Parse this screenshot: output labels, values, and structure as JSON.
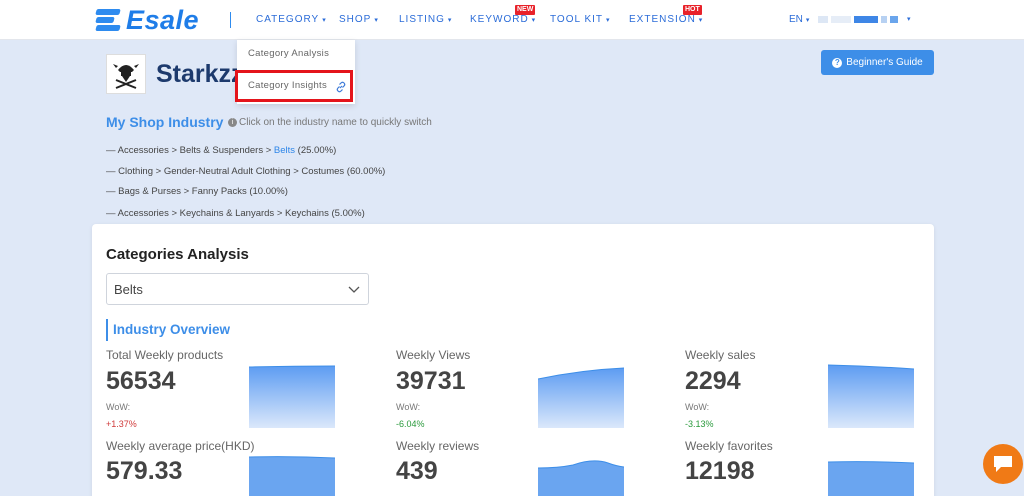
{
  "header": {
    "logo_text": "Esale",
    "nav": [
      {
        "label": "CATEGORY"
      },
      {
        "label": "SHOP"
      },
      {
        "label": "LISTING"
      },
      {
        "label": "KEYWORD",
        "badge": "NEW"
      },
      {
        "label": "TOOL KIT"
      },
      {
        "label": "EXTENSION",
        "badge": "HOT"
      }
    ],
    "lang": "EN",
    "brand_color": "#1f7de8"
  },
  "dropdown": {
    "items": [
      "Category Analysis",
      "Category Insights"
    ]
  },
  "shop": {
    "name": "Starkzz",
    "guide_label": "Beginner's Guide"
  },
  "industry": {
    "title": "My Shop Industry",
    "hint": "Click on the industry name to quickly switch",
    "lines": [
      {
        "prefix": "— Accessories > Belts & Suspenders > ",
        "link": "Belts",
        "suffix": " (25.00%)"
      },
      {
        "prefix": "— Clothing > Gender-Neutral Adult Clothing > Costumes (60.00%)",
        "link": "",
        "suffix": ""
      },
      {
        "prefix": "— Bags & Purses > Fanny Packs (10.00%)",
        "link": "",
        "suffix": ""
      },
      {
        "prefix": "— Accessories > Keychains & Lanyards > Keychains (5.00%)",
        "link": "",
        "suffix": ""
      }
    ]
  },
  "analysis": {
    "title": "Categories Analysis",
    "selected": "Belts",
    "overview_title": "Industry Overview",
    "wow_label": "WoW:",
    "stats": [
      {
        "label": "Total Weekly products",
        "value": "56534",
        "wow": "+1.37%"
      },
      {
        "label": "Weekly Views",
        "value": "39731",
        "wow": "-6.04%"
      },
      {
        "label": "Weekly sales",
        "value": "2294",
        "wow": "-3.13%"
      },
      {
        "label": "Weekly average price(HKD)",
        "value": "579.33",
        "wow": ""
      },
      {
        "label": "Weekly reviews",
        "value": "439",
        "wow": ""
      },
      {
        "label": "Weekly favorites",
        "value": "12198",
        "wow": ""
      }
    ]
  },
  "colors": {
    "accent": "#3d8ee8",
    "highlight_border": "#e4141b",
    "chat": "#f07a16"
  }
}
